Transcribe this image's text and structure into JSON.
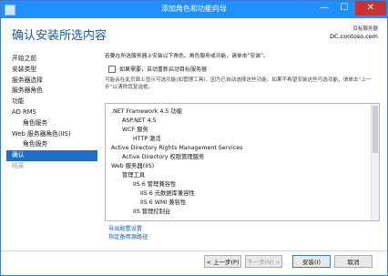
{
  "window": {
    "title": "添加角色和功能向导",
    "controls": {
      "minimize": "—",
      "maximize": "☐",
      "close": "✕"
    }
  },
  "header": {
    "title": "确认安装所选内容",
    "server_label": "目标服务器",
    "server_name": "DC.contoso.com"
  },
  "sidebar": {
    "items": [
      {
        "label": "开始之前",
        "state": "normal"
      },
      {
        "label": "安装类型",
        "state": "normal"
      },
      {
        "label": "服务器选择",
        "state": "normal"
      },
      {
        "label": "服务器角色",
        "state": "normal"
      },
      {
        "label": "功能",
        "state": "normal"
      },
      {
        "label": "AD RMS",
        "state": "normal"
      },
      {
        "label": "角色服务",
        "state": "sub"
      },
      {
        "label": "Web 服务器角色(IIS)",
        "state": "normal"
      },
      {
        "label": "角色服务",
        "state": "sub"
      },
      {
        "label": "确认",
        "state": "active"
      },
      {
        "label": "结果",
        "state": "disabled"
      }
    ]
  },
  "content": {
    "intro": "若要在所选服务器上安装以下角色、角色服务或功能，请单击“安装”。",
    "restart_label": "如果需要，自动重新启动目标服务器",
    "restart_checked": false,
    "note": "可能会在此页面上显示可选功能(如管理工具)，因为已自动选择这些功能。如果不希望安装这些可选功能，请单击“上一步”以清除其复选框。"
  },
  "features": [
    {
      "text": ".NET Framework 4.5 功能",
      "indent": 0
    },
    {
      "text": "ASP.NET 4.5",
      "indent": 1
    },
    {
      "text": "WCF 服务",
      "indent": 1
    },
    {
      "text": "HTTP 激活",
      "indent": 2
    },
    {
      "text": "Active Directory Rights Management Services",
      "indent": 0
    },
    {
      "text": "Active Directory 权限管理服务",
      "indent": 1
    },
    {
      "text": "Web 服务器(IIS)",
      "indent": 0
    },
    {
      "text": "管理工具",
      "indent": 1
    },
    {
      "text": "IIS 6 管理兼容性",
      "indent": 2
    },
    {
      "text": "IIS 6 元数据库兼容性",
      "indent": 3
    },
    {
      "text": "IIS 6 WMI 兼容性",
      "indent": 3
    },
    {
      "text": "IIS 管理控制台",
      "indent": 2
    }
  ],
  "links": {
    "export": "导出配置设置",
    "alt_source": "指定备用源路径"
  },
  "buttons": {
    "prev": "< 上一步(P)",
    "next": "下一步(N) >",
    "install": "安装(I)",
    "cancel": "取消"
  }
}
